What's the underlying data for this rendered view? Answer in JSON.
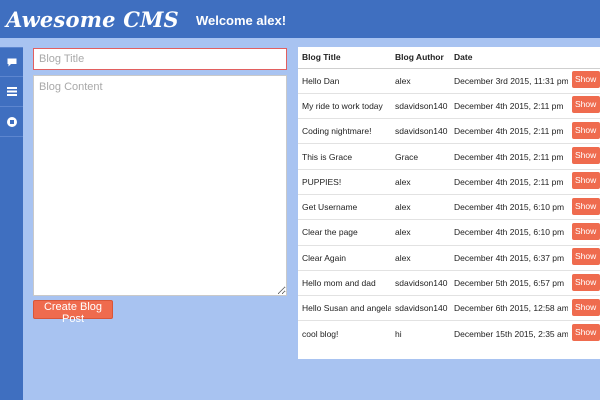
{
  "header": {
    "brand": "Awesome CMS",
    "welcome": "Welcome alex!"
  },
  "sidebar": {
    "items": [
      {
        "icon": "comment-icon"
      },
      {
        "icon": "list-icon"
      },
      {
        "icon": "stop-circle-icon"
      }
    ]
  },
  "form": {
    "title_placeholder": "Blog Title",
    "content_placeholder": "Blog Content",
    "submit_label": "Create Blog Post"
  },
  "table": {
    "headers": [
      "Blog Title",
      "Blog Author",
      "Date"
    ],
    "show_label": "Show",
    "rows": [
      {
        "title": "Hello Dan",
        "author": "alex",
        "date": "December 3rd 2015, 11:31 pm"
      },
      {
        "title": "My ride to work today",
        "author": "sdavidson140",
        "date": "December 4th 2015, 2:11 pm"
      },
      {
        "title": "Coding nightmare!",
        "author": "sdavidson140",
        "date": "December 4th 2015, 2:11 pm"
      },
      {
        "title": "This is Grace",
        "author": "Grace",
        "date": "December 4th 2015, 2:11 pm"
      },
      {
        "title": "PUPPIES!",
        "author": "alex",
        "date": "December 4th 2015, 2:11 pm"
      },
      {
        "title": "Get Username",
        "author": "alex",
        "date": "December 4th 2015, 6:10 pm"
      },
      {
        "title": "Clear the page",
        "author": "alex",
        "date": "December 4th 2015, 6:10 pm"
      },
      {
        "title": "Clear Again",
        "author": "alex",
        "date": "December 4th 2015, 6:37 pm"
      },
      {
        "title": "Hello mom and dad",
        "author": "sdavidson140",
        "date": "December 5th 2015, 6:57 pm"
      },
      {
        "title": "Hello Susan and angela",
        "author": "sdavidson140",
        "date": "December 6th 2015, 12:58 am"
      },
      {
        "title": "cool blog!",
        "author": "hi",
        "date": "December 15th 2015, 2:35 am"
      }
    ]
  },
  "colors": {
    "header_bg": "#3f6fc0",
    "page_bg": "#a8c3f1",
    "accent": "#ef6b4e"
  }
}
